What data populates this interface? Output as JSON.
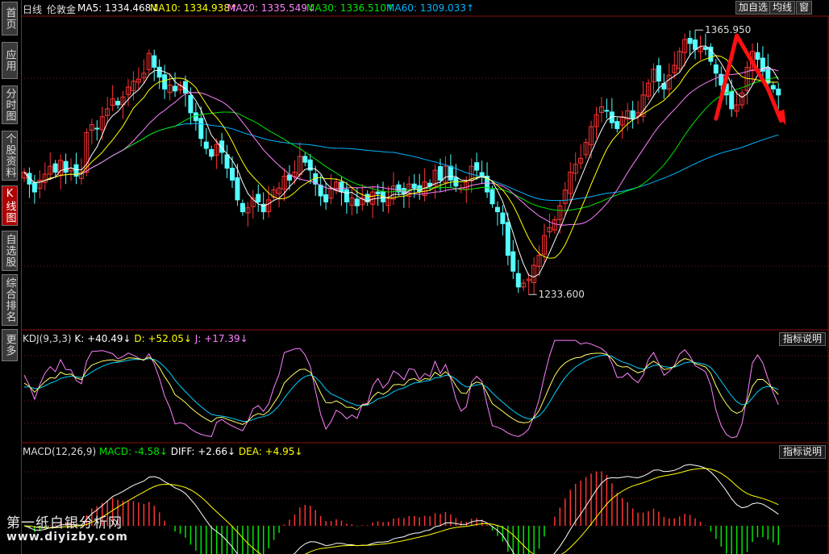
{
  "sidebar": {
    "tabs": [
      {
        "label": "首页",
        "active": false
      },
      {
        "label": "应用",
        "active": false
      },
      {
        "label": "分时图",
        "active": false
      },
      {
        "label": "个股资料",
        "active": false
      },
      {
        "label": "K线图",
        "active": true
      },
      {
        "label": "自选股",
        "active": false
      },
      {
        "label": "综合排名",
        "active": false
      },
      {
        "label": "更多",
        "active": false
      }
    ]
  },
  "header": {
    "period": "日线",
    "symbol": "伦敦金",
    "ma5": "MA5: 1334.468↓",
    "ma10": "MA10: 1334.938↑",
    "ma20": "MA20: 1335.549↓",
    "ma30": "MA30: 1336.510↑",
    "ma60": "MA60: 1309.033↑",
    "btn_add": "加自选",
    "btn_avg": "均线",
    "btn_window": "窗"
  },
  "kdj": {
    "label": "KDJ(9,3,3)",
    "k": "K: +40.49↓",
    "d": "D: +52.05↓",
    "j": "J: +17.39↓",
    "help": "指标说明"
  },
  "macd": {
    "label": "MACD(12,26,9)",
    "macd": "MACD: -4.58↓",
    "diff": "DIFF: +2.66↓",
    "dea": "DEA: +4.95↓",
    "help": "指标说明"
  },
  "watermark": {
    "line1": "第一纸白银分析网",
    "line2": "www.diyizby.com"
  },
  "colors": {
    "up": "#ff3333",
    "down": "#54ffff",
    "ma5": "#ffffff",
    "ma10": "#ffff00",
    "ma20": "#ff80ff",
    "ma30": "#00e600",
    "ma60": "#00b4ff",
    "arrow": "#ff1010"
  },
  "chart_data": {
    "type": "candlestick",
    "title": "伦敦金 日线",
    "price_annotations": {
      "high": "1365.950",
      "low": "1233.600"
    },
    "ylim": [
      1218,
      1374
    ],
    "close_series": [
      1296,
      1290,
      1286,
      1292,
      1295,
      1299,
      1296,
      1302,
      1296,
      1298,
      1294,
      1296,
      1316,
      1320,
      1318,
      1324,
      1328,
      1333,
      1330,
      1334,
      1339,
      1342,
      1343,
      1346,
      1356,
      1349,
      1344,
      1338,
      1340,
      1337,
      1340,
      1336,
      1326,
      1322,
      1313,
      1308,
      1304,
      1310,
      1306,
      1298,
      1292,
      1282,
      1276,
      1278,
      1283,
      1281,
      1276,
      1282,
      1287,
      1288,
      1294,
      1292,
      1296,
      1304,
      1301,
      1297,
      1290,
      1284,
      1281,
      1288,
      1291,
      1286,
      1281,
      1283,
      1279,
      1283,
      1281,
      1286,
      1285,
      1281,
      1283,
      1289,
      1286,
      1285,
      1290,
      1288,
      1286,
      1291,
      1289,
      1297,
      1292,
      1299,
      1292,
      1289,
      1288,
      1291,
      1299,
      1297,
      1294,
      1286,
      1280,
      1276,
      1270,
      1254,
      1246,
      1238,
      1240,
      1242,
      1249,
      1254,
      1264,
      1268,
      1272,
      1279,
      1287,
      1296,
      1300,
      1303,
      1311,
      1319,
      1325,
      1329,
      1327,
      1321,
      1318,
      1324,
      1327,
      1323,
      1326,
      1335,
      1341,
      1348,
      1342,
      1338,
      1345,
      1350,
      1357,
      1363,
      1361,
      1358,
      1359,
      1358,
      1352,
      1346,
      1340,
      1335,
      1328,
      1330,
      1336,
      1349,
      1357,
      1353,
      1347,
      1341,
      1338,
      1335
    ],
    "indicators": {
      "MA5": 1334.468,
      "MA10": 1334.938,
      "MA20": 1335.549,
      "MA30": 1336.51,
      "MA60": 1309.033,
      "KDJ": {
        "params": "9,3,3",
        "K": 40.49,
        "D": 52.05,
        "J": 17.39
      },
      "MACD": {
        "params": "12,26,9",
        "MACD": -4.58,
        "DIFF": 2.66,
        "DEA": 4.95
      }
    }
  }
}
